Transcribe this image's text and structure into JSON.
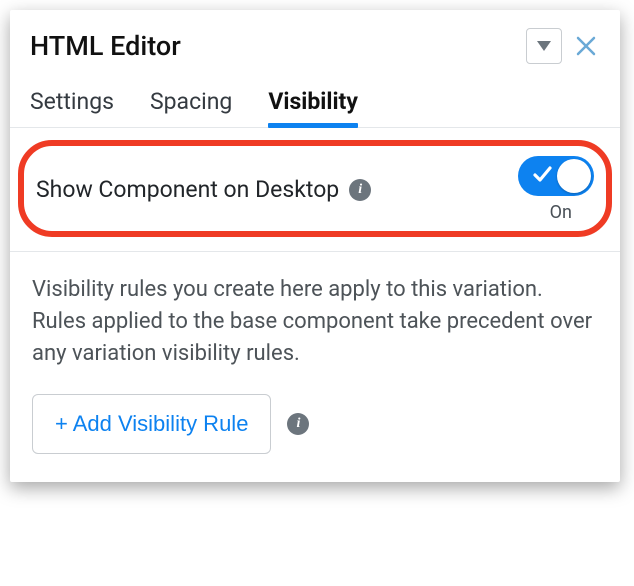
{
  "header": {
    "title": "HTML Editor"
  },
  "tabs": [
    {
      "label": "Settings",
      "active": false
    },
    {
      "label": "Spacing",
      "active": false
    },
    {
      "label": "Visibility",
      "active": true
    }
  ],
  "visibility": {
    "toggle_label": "Show Component on Desktop",
    "toggle_state": "On",
    "description": "Visibility rules you create here apply to this variation. Rules applied to the base component take precedent over any variation visibility rules.",
    "add_button_label": "+ Add Visibility Rule"
  },
  "icons": {
    "info_glyph": "i"
  }
}
